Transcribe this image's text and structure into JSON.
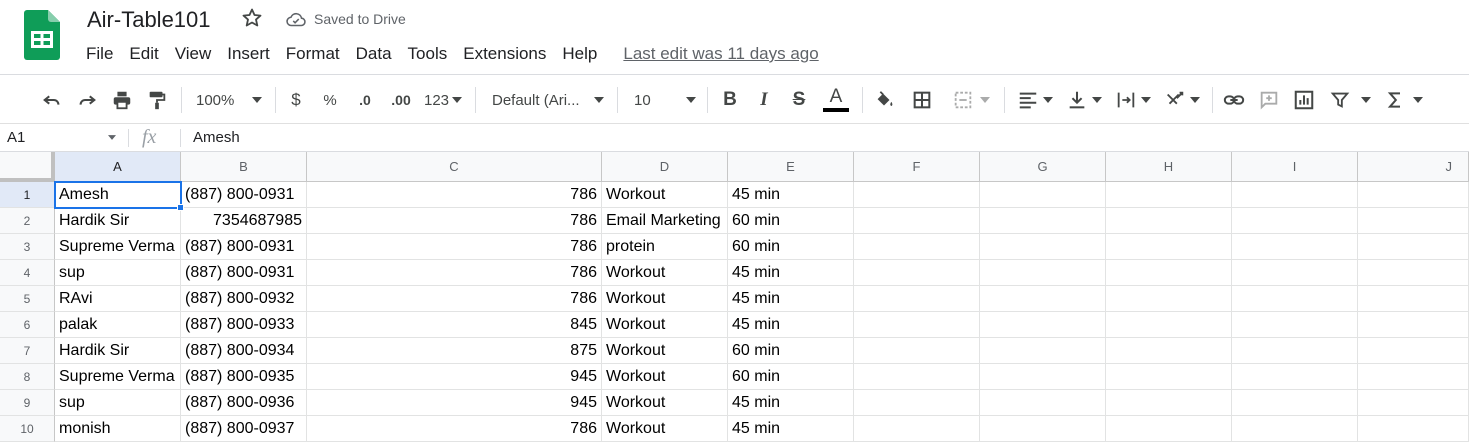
{
  "document": {
    "title": "Air-Table101",
    "save_status": "Saved to Drive"
  },
  "menu": {
    "items": [
      "File",
      "Edit",
      "View",
      "Insert",
      "Format",
      "Data",
      "Tools",
      "Extensions",
      "Help"
    ],
    "last_edit": "Last edit was 11 days ago"
  },
  "toolbar": {
    "zoom": "100%",
    "currency": "$",
    "percent": "%",
    "decrease_decimal": ".0",
    "increase_decimal": ".00",
    "more_formats": "123",
    "font": "Default (Ari...",
    "font_size": "10",
    "bold": "B",
    "italic": "I",
    "strikethrough": "S",
    "text_color_letter": "A"
  },
  "formula_bar": {
    "cell_ref": "A1",
    "fx": "fx",
    "value": "Amesh"
  },
  "grid": {
    "columns": [
      "A",
      "B",
      "C",
      "D",
      "E",
      "F",
      "G",
      "H",
      "I",
      "J"
    ],
    "row_numbers": [
      "1",
      "2",
      "3",
      "4",
      "5",
      "6",
      "7",
      "8",
      "9",
      "10"
    ],
    "rows": [
      [
        "Amesh",
        "(887) 800-0931",
        "786",
        "Workout",
        "45 min"
      ],
      [
        "Hardik Sir",
        "7354687985",
        "786",
        "Email Marketing",
        "60 min"
      ],
      [
        "Supreme Verma",
        "(887) 800-0931",
        "786",
        "protein",
        "60 min"
      ],
      [
        "sup",
        "(887) 800-0931",
        "786",
        "Workout",
        "45 min"
      ],
      [
        "RAvi",
        "(887) 800-0932",
        "786",
        "Workout",
        "45 min"
      ],
      [
        "palak",
        "(887) 800-0933",
        "845",
        "Workout",
        "45 min"
      ],
      [
        "Hardik Sir",
        "(887) 800-0934",
        "875",
        "Workout",
        "60 min"
      ],
      [
        "Supreme Verma",
        "(887) 800-0935",
        "945",
        "Workout",
        "60 min"
      ],
      [
        "sup",
        "(887) 800-0936",
        "945",
        "Workout",
        "45 min"
      ],
      [
        "monish",
        "(887) 800-0937",
        "786",
        "Workout",
        "45 min"
      ]
    ]
  },
  "colors": {
    "sheets_green": "#0f9d58",
    "selection_blue": "#1a73e8",
    "header_bg": "#f8f9fa",
    "selected_header_bg": "#e1e9f7"
  }
}
